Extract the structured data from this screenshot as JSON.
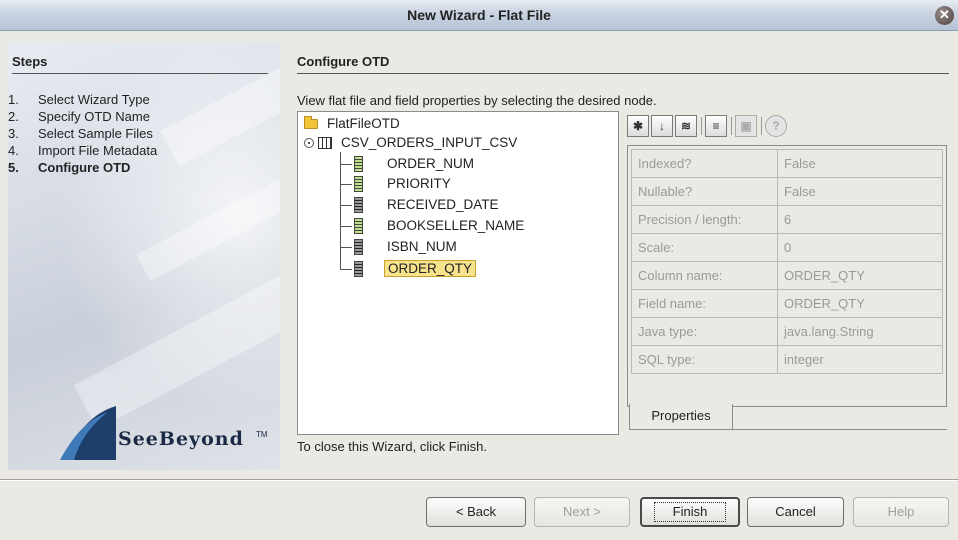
{
  "window": {
    "title": "New Wizard - Flat File"
  },
  "steps": {
    "heading": "Steps",
    "items": [
      {
        "num": "1.",
        "label": "Select Wizard Type",
        "active": false
      },
      {
        "num": "2.",
        "label": "Specify OTD Name",
        "active": false
      },
      {
        "num": "3.",
        "label": "Select Sample Files",
        "active": false
      },
      {
        "num": "4.",
        "label": "Import File Metadata",
        "active": false
      },
      {
        "num": "5.",
        "label": "Configure OTD",
        "active": true
      }
    ],
    "logo_text": "SeeBeyond",
    "logo_tm": "TM"
  },
  "main": {
    "section_title": "Configure OTD",
    "instruction": "View flat file and field properties by selecting the desired node.",
    "close_hint": "To close this Wizard, click Finish."
  },
  "tree": {
    "root": "FlatFileOTD",
    "record": "CSV_ORDERS_INPUT_CSV",
    "fields": [
      "ORDER_NUM",
      "PRIORITY",
      "RECEIVED_DATE",
      "BOOKSELLER_NAME",
      "ISBN_NUM",
      "ORDER_QTY"
    ],
    "selected": "ORDER_QTY"
  },
  "properties": {
    "tab_label": "Properties",
    "rows": [
      {
        "key": "Indexed?",
        "value": "False"
      },
      {
        "key": "Nullable?",
        "value": "False"
      },
      {
        "key": "Precision / length:",
        "value": "6"
      },
      {
        "key": "Scale:",
        "value": "0"
      },
      {
        "key": "Column name:",
        "value": "ORDER_QTY"
      },
      {
        "key": "Field name:",
        "value": "ORDER_QTY"
      },
      {
        "key": "Java type:",
        "value": "java.lang.String"
      },
      {
        "key": "SQL type:",
        "value": "integer"
      }
    ],
    "toolbar_icons": [
      "collapse-icon",
      "sort-icon",
      "categorized-icon",
      "description-toggle-icon",
      "edit-icon",
      "help-icon"
    ]
  },
  "buttons": {
    "back": "< Back",
    "next": "Next >",
    "finish": "Finish",
    "cancel": "Cancel",
    "help": "Help"
  }
}
